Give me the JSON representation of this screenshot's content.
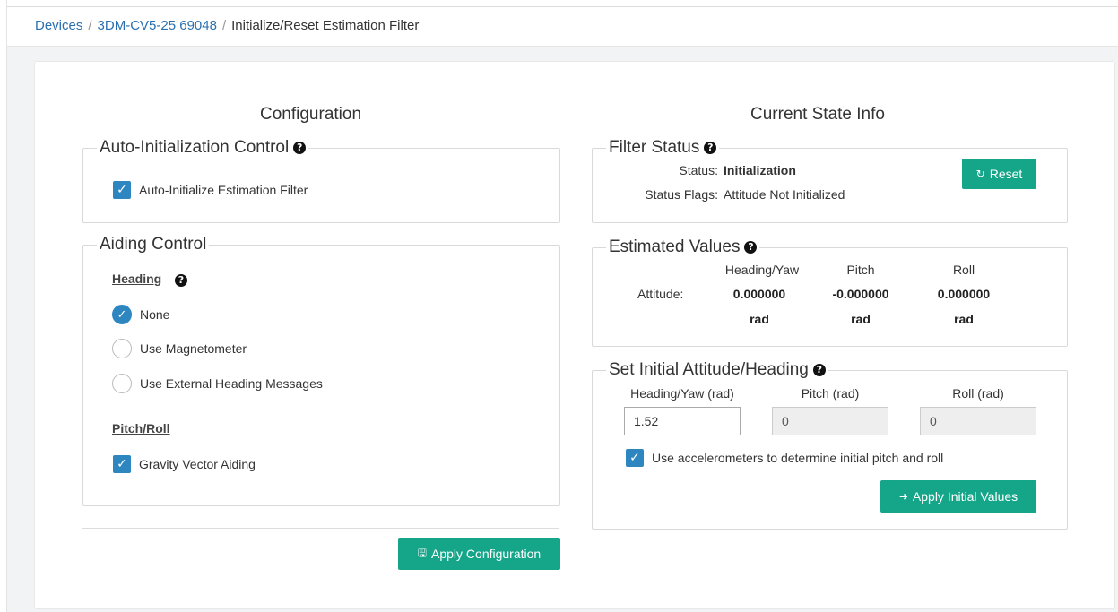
{
  "breadcrumb": {
    "items": [
      "Devices",
      "3DM-CV5-25 69048"
    ],
    "current": "Initialize/Reset Estimation Filter",
    "sep": "/"
  },
  "configuration": {
    "title": "Configuration",
    "auto_init": {
      "legend": "Auto-Initialization Control",
      "checkbox_label": "Auto-Initialize Estimation Filter",
      "checked": true
    },
    "aiding": {
      "legend": "Aiding Control",
      "heading_label": "Heading",
      "heading_options": [
        {
          "label": "None",
          "selected": true
        },
        {
          "label": "Use Magnetometer",
          "selected": false
        },
        {
          "label": "Use External Heading Messages",
          "selected": false
        }
      ],
      "pitchroll_label": "Pitch/Roll",
      "gravity_label": "Gravity Vector Aiding",
      "gravity_checked": true
    },
    "apply_button": "Apply Configuration"
  },
  "state": {
    "title": "Current State Info",
    "filter_status": {
      "legend": "Filter Status",
      "status_key": "Status:",
      "status_value": "Initialization",
      "flags_key": "Status Flags:",
      "flags_value": "Attitude Not Initialized",
      "reset_button": "Reset"
    },
    "estimated": {
      "legend": "Estimated Values",
      "headers": [
        "Heading/Yaw",
        "Pitch",
        "Roll"
      ],
      "row_label": "Attitude:",
      "values": [
        "0.000000",
        "-0.000000",
        "0.000000"
      ],
      "unit": "rad"
    },
    "initial": {
      "legend": "Set Initial Attitude/Heading",
      "labels": [
        "Heading/Yaw (rad)",
        "Pitch (rad)",
        "Roll (rad)"
      ],
      "values": [
        "1.52",
        "0",
        "0"
      ],
      "accel_label": "Use accelerometers to determine initial pitch and roll",
      "accel_checked": true,
      "apply_button": "Apply Initial Values"
    }
  },
  "icons": {
    "help": "question-circle-icon",
    "check": "checkmark-icon",
    "save": "floppy-disk-icon",
    "reset": "refresh-icon",
    "apply": "arrow-circle-right-icon"
  },
  "colors": {
    "accent": "#15a589",
    "checkbox": "#2e86c1",
    "link": "#2a6fb0"
  }
}
